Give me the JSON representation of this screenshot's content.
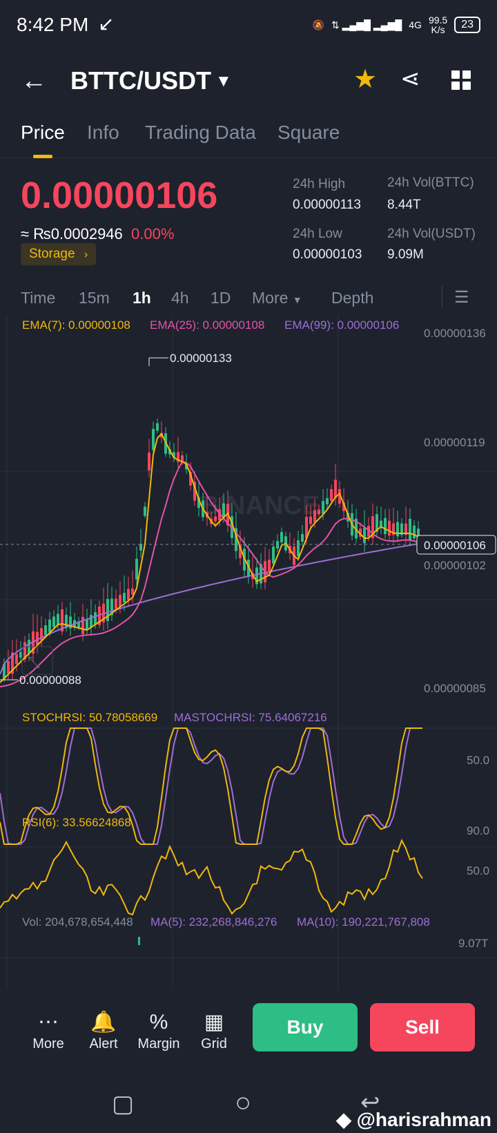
{
  "status_bar": {
    "time": "8:42 PM",
    "net": "4G",
    "speed_value": "99.5",
    "speed_unit": "K/s",
    "battery": "23"
  },
  "header": {
    "pair": "BTTC/USDT"
  },
  "tabs": [
    "Price",
    "Info",
    "Trading Data",
    "Square"
  ],
  "price": {
    "last": "0.00000106",
    "converted": "≈ ₨0.0002946",
    "change_pct": "0.00%",
    "tag": "Storage",
    "high_label": "24h High",
    "high_value": "0.00000113",
    "low_label": "24h Low",
    "low_value": "0.00000103",
    "vol_btt_label": "24h Vol(BTTC)",
    "vol_btt_value": "8.44T",
    "vol_usdt_label": "24h Vol(USDT)",
    "vol_usdt_value": "9.09M"
  },
  "intervals": [
    "Time",
    "15m",
    "1h",
    "4h",
    "1D",
    "More",
    "Depth"
  ],
  "chart": {
    "ema7": "EMA(7): 0.00000108",
    "ema25": "EMA(25): 0.00000108",
    "ema99": "EMA(99): 0.00000106",
    "y_ticks": [
      "0.00000136",
      "0.00000119",
      "0.00000102",
      "0.00000085"
    ],
    "high_marker": "0.00000133",
    "low_marker": "0.00000088",
    "current_price": "0.00000106",
    "watermark": "BINANCE",
    "colors": {
      "up": "#2ebd85",
      "down": "#f6465d",
      "ema7": "#f0b90b",
      "ema25": "#e254a8",
      "ema99": "#9d6fd6"
    }
  },
  "stoch": {
    "label": "STOCHRSI: 50.78058669",
    "ma_label": "MASTOCHRSI: 75.64067216",
    "tick": "50.0"
  },
  "rsi": {
    "label": "RSI(6): 33.56624868",
    "ticks": [
      "90.0",
      "50.0"
    ]
  },
  "volume": {
    "vol": "Vol: 204,678,654,448",
    "ma5": "MA(5): 232,268,846,276",
    "ma10": "MA(10): 190,221,767,808",
    "tick": "9.07T"
  },
  "toolbar": {
    "more": "More",
    "alert": "Alert",
    "margin": "Margin",
    "grid": "Grid",
    "buy": "Buy",
    "sell": "Sell"
  },
  "watermark": "@harisrahman"
}
